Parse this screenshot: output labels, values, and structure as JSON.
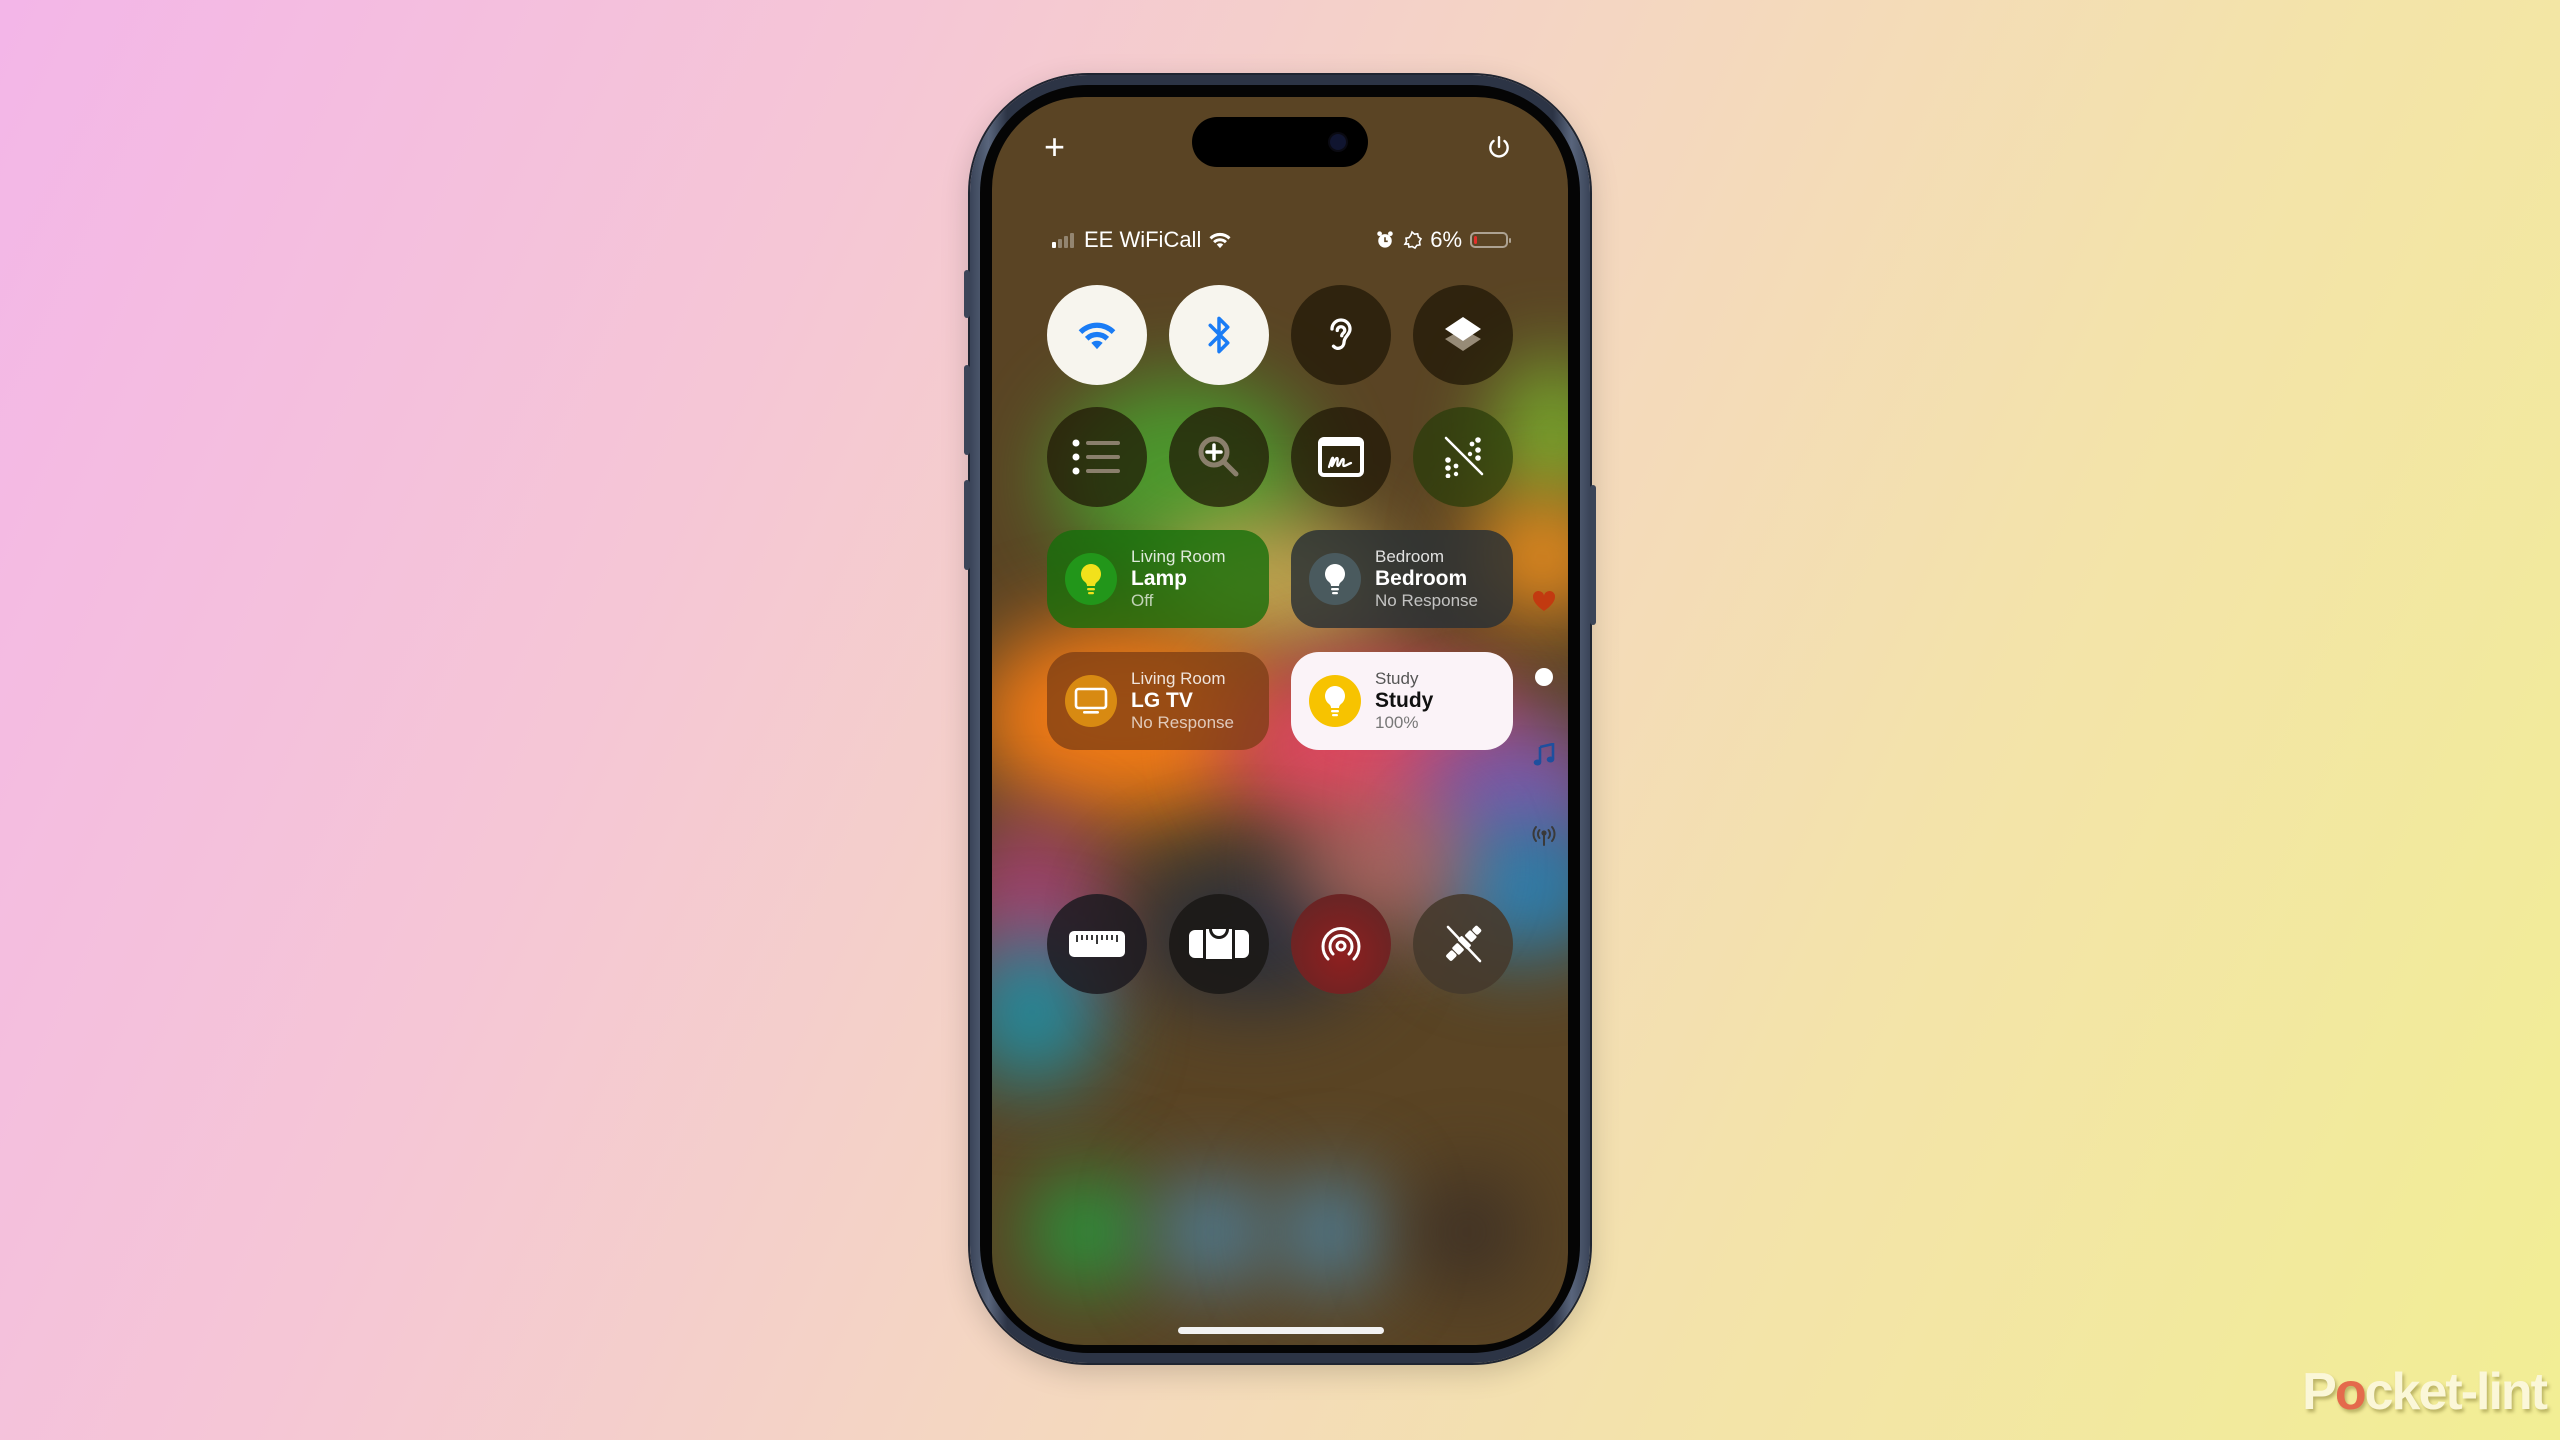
{
  "top_controls": {
    "add_label": "+",
    "power_icon": "power-icon"
  },
  "status_bar": {
    "carrier": "EE WiFiCall",
    "signal_bars_active": 1,
    "signal_bars_total": 4,
    "wifi_icon": "wifi-icon",
    "alarm_icon": "alarm-icon",
    "focus_icon": "sun-rotation-icon",
    "battery_percent_label": "6%",
    "battery_level": 0.06,
    "battery_color": "#e2302a"
  },
  "controls_row1": [
    {
      "name": "wifi",
      "icon": "wifi-icon",
      "active": true,
      "accent": "#1a7cf5"
    },
    {
      "name": "bluetooth",
      "icon": "bluetooth-icon",
      "active": true,
      "accent": "#1a7cf5"
    },
    {
      "name": "hearing",
      "icon": "ear-icon",
      "active": false
    },
    {
      "name": "stacked-layers",
      "icon": "layers-icon",
      "active": false
    }
  ],
  "controls_row2": [
    {
      "name": "list",
      "icon": "list-icon",
      "active": false
    },
    {
      "name": "magnifier",
      "icon": "zoom-in-icon",
      "active": false
    },
    {
      "name": "signature",
      "icon": "signature-icon",
      "active": false
    },
    {
      "name": "dots-off",
      "icon": "dots-slash-icon",
      "active": false
    }
  ],
  "home_tiles": [
    {
      "room": "Living Room",
      "name": "Lamp",
      "state": "Off",
      "icon": "lightbulb-icon",
      "theme": "green"
    },
    {
      "room": "Bedroom",
      "name": "Bedroom",
      "state": "No Response",
      "icon": "lightbulb-icon",
      "theme": "gray"
    },
    {
      "room": "Living Room",
      "name": "LG TV",
      "state": "No Response",
      "icon": "tv-icon",
      "theme": "orange"
    },
    {
      "room": "Study",
      "name": "Study",
      "state": "100%",
      "icon": "lightbulb-icon",
      "theme": "light",
      "accent": "#f7c300"
    }
  ],
  "side_page_indicators": [
    {
      "icon": "heart-icon",
      "color": "#c23a10"
    },
    {
      "icon": "dot-icon",
      "color": "#ffffff",
      "current": true
    },
    {
      "icon": "music-note-icon",
      "color": "#1e4f9e"
    },
    {
      "icon": "antenna-icon",
      "color": "#3a3a3a"
    }
  ],
  "controls_row3": [
    {
      "name": "measure",
      "icon": "ruler-icon"
    },
    {
      "name": "level",
      "icon": "level-icon"
    },
    {
      "name": "airdrop",
      "icon": "airdrop-icon",
      "accent": "#8a1f1f"
    },
    {
      "name": "satellite-off",
      "icon": "satellite-slash-icon"
    }
  ],
  "watermark": {
    "pre": "P",
    "o": "o",
    "post": "cket-lint"
  }
}
